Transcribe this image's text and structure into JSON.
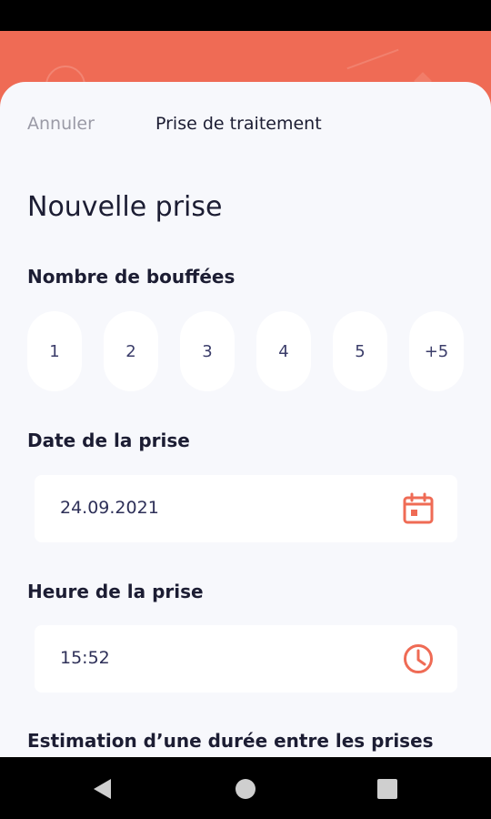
{
  "header": {
    "accent_color": "#ef6b55",
    "cancel_label": "Annuler",
    "title": "Prise de traitement"
  },
  "form": {
    "heading": "Nouvelle prise",
    "puffs": {
      "label": "Nombre de bouffées",
      "options": [
        "1",
        "2",
        "3",
        "4",
        "5",
        "+5"
      ]
    },
    "date": {
      "label": "Date de la prise",
      "value": "24.09.2021",
      "icon": "calendar-icon"
    },
    "time": {
      "label": "Heure de la prise",
      "value": "15:52",
      "icon": "clock-icon"
    },
    "estimation": {
      "label": "Estimation d’une durée entre les prises"
    }
  },
  "navbar": {
    "buttons": [
      "back-icon",
      "home-icon",
      "recents-icon"
    ]
  }
}
